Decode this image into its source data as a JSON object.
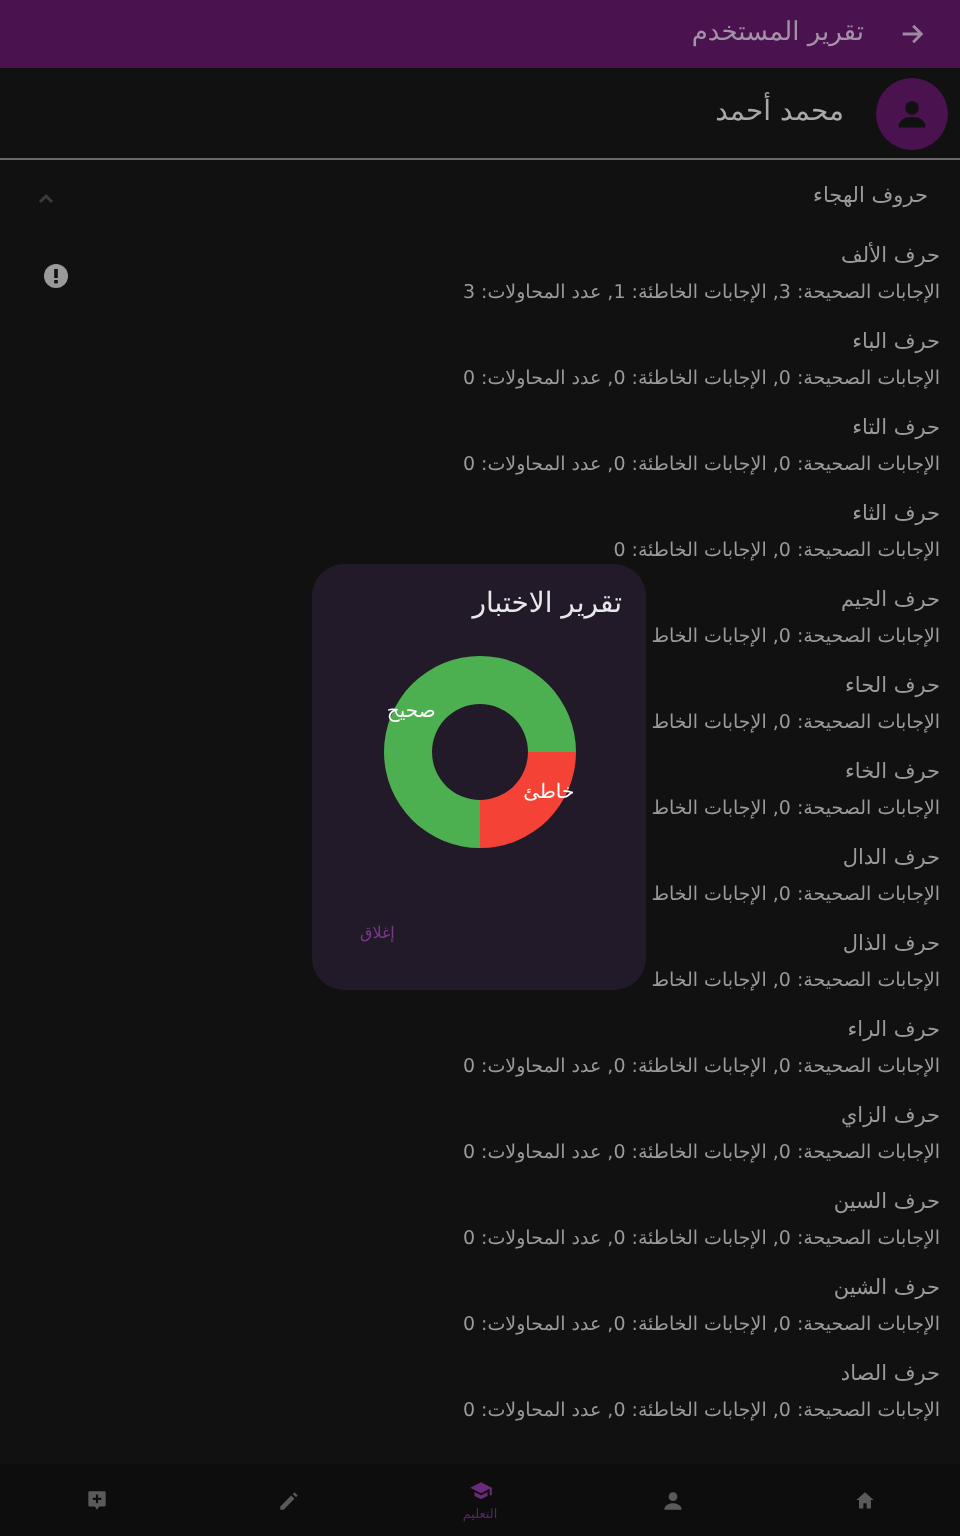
{
  "app_bar": {
    "title": "تقرير المستخدم"
  },
  "user": {
    "name": "محمد أحمد"
  },
  "section": {
    "title": "حروف الهجاء",
    "expanded": true
  },
  "letters": [
    {
      "title": "حرف الألف",
      "stats": "الإجابات الصحيحة: 3, الإجابات الخاطئة: 1, عدد المحاولات: 3",
      "alert": true
    },
    {
      "title": "حرف الباء",
      "stats": "الإجابات الصحيحة: 0, الإجابات الخاطئة: 0, عدد المحاولات: 0",
      "alert": false
    },
    {
      "title": "حرف التاء",
      "stats": "الإجابات الصحيحة: 0, الإجابات الخاطئة: 0, عدد المحاولات: 0",
      "alert": false
    },
    {
      "title": "حرف الثاء",
      "stats": "الإجابات الصحيحة: 0, الإجابات الخاطئة: 0",
      "alert": false
    },
    {
      "title": "حرف الجيم",
      "stats": "الإجابات الصحيحة: 0, الإجابات الخاط",
      "alert": false
    },
    {
      "title": "حرف الحاء",
      "stats": "الإجابات الصحيحة: 0, الإجابات الخاط",
      "alert": false
    },
    {
      "title": "حرف الخاء",
      "stats": "الإجابات الصحيحة: 0, الإجابات الخاط",
      "alert": false
    },
    {
      "title": "حرف الدال",
      "stats": "الإجابات الصحيحة: 0, الإجابات الخاط",
      "alert": false
    },
    {
      "title": "حرف الذال",
      "stats": "الإجابات الصحيحة: 0, الإجابات الخاط",
      "alert": false
    },
    {
      "title": "حرف الراء",
      "stats": "الإجابات الصحيحة: 0, الإجابات الخاطئة: 0, عدد المحاولات: 0",
      "alert": false
    },
    {
      "title": "حرف الزاي",
      "stats": "الإجابات الصحيحة: 0, الإجابات الخاطئة: 0, عدد المحاولات: 0",
      "alert": false
    },
    {
      "title": "حرف السين",
      "stats": "الإجابات الصحيحة: 0, الإجابات الخاطئة: 0, عدد المحاولات: 0",
      "alert": false
    },
    {
      "title": "حرف الشين",
      "stats": "الإجابات الصحيحة: 0, الإجابات الخاطئة: 0, عدد المحاولات: 0",
      "alert": false
    },
    {
      "title": "حرف الصاد",
      "stats": "الإجابات الصحيحة: 0, الإجابات الخاطئة: 0, عدد المحاولات: 0",
      "alert": false
    }
  ],
  "dialog": {
    "title": "تقرير الاختبار",
    "close": "إغلاق",
    "chart_data": {
      "type": "donut",
      "categories": [
        "صحيح",
        "خاطئ"
      ],
      "values": [
        75,
        25
      ],
      "colors": [
        "#4caf50",
        "#f44336"
      ]
    }
  },
  "bottom_nav": [
    {
      "kind": "home",
      "selected": false
    },
    {
      "kind": "person",
      "selected": false
    },
    {
      "kind": "school",
      "selected": true,
      "label": "التعليم"
    },
    {
      "kind": "edit",
      "selected": false
    },
    {
      "kind": "comment",
      "selected": false
    }
  ]
}
